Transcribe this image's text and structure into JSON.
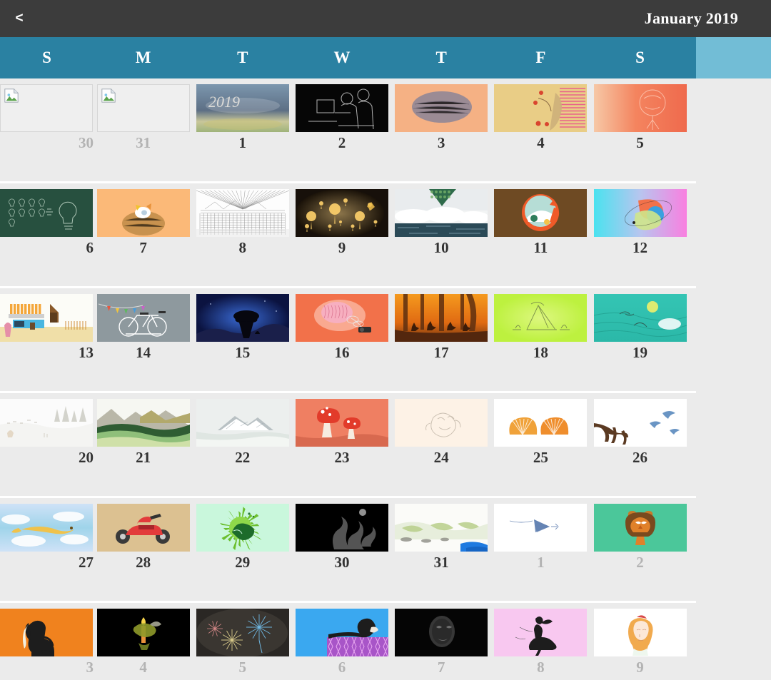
{
  "appbar": {
    "back_icon": "chevron-left-icon",
    "back_label": "<",
    "title": "January 2019",
    "background": "#3c3c3c"
  },
  "weekbar": {
    "background": "#2a81a2",
    "gutter_background": "#72bdd6",
    "days": [
      {
        "label": "S"
      },
      {
        "label": "M"
      },
      {
        "label": "T"
      },
      {
        "label": "W"
      },
      {
        "label": "T"
      },
      {
        "label": "F"
      },
      {
        "label": "S"
      }
    ]
  },
  "calendar": {
    "month": "January",
    "year": "2019",
    "current_day_color": "#333333",
    "other_month_day_color": "#b3b3b3",
    "cell_background": "#ebebeb",
    "row_separator_color": "#ffffff",
    "weeks": [
      {
        "days": [
          {
            "num": "30",
            "in_month": false,
            "has_image": false,
            "image_state": "broken",
            "alt": "missing-thumbnail"
          },
          {
            "num": "31",
            "in_month": false,
            "has_image": false,
            "image_state": "broken",
            "alt": "missing-thumbnail"
          },
          {
            "num": "1",
            "in_month": true,
            "has_image": true,
            "art": "sky2019",
            "alt": "2019 written in clouds over a field"
          },
          {
            "num": "2",
            "in_month": true,
            "has_image": true,
            "art": "sketchfigures",
            "alt": "white line sketch of figures on black"
          },
          {
            "num": "3",
            "in_month": true,
            "has_image": true,
            "art": "furoval",
            "alt": "hairy oval shape on peach background"
          },
          {
            "num": "4",
            "in_month": true,
            "has_image": true,
            "art": "personstripes",
            "alt": "figure with fruit and pink stripes"
          },
          {
            "num": "5",
            "in_month": true,
            "has_image": true,
            "art": "redtree",
            "alt": "pale tree on red-orange wash"
          }
        ]
      },
      {
        "days": [
          {
            "num": "6",
            "in_month": true,
            "has_image": true,
            "art": "chalkboard",
            "alt": "chalkboard with light bulbs"
          },
          {
            "num": "7",
            "in_month": true,
            "has_image": true,
            "art": "nest",
            "alt": "bird in a nest on orange"
          },
          {
            "num": "8",
            "in_month": true,
            "has_image": true,
            "art": "linescape",
            "alt": "pen line drawing of mountains and field"
          },
          {
            "num": "9",
            "in_month": true,
            "has_image": true,
            "art": "goldlights",
            "alt": "glowing golden lights on dark background"
          },
          {
            "num": "10",
            "in_month": true,
            "has_image": true,
            "art": "cloudsea",
            "alt": "clouds above a dark sea"
          },
          {
            "num": "11",
            "in_month": true,
            "has_image": true,
            "art": "foxcircle",
            "alt": "sleeping fox in a circle on brown"
          },
          {
            "num": "12",
            "in_month": true,
            "has_image": true,
            "art": "planetswirl",
            "alt": "abstract swirl on cyan to pink gradient"
          }
        ]
      },
      {
        "days": [
          {
            "num": "13",
            "in_month": true,
            "has_image": true,
            "art": "market",
            "alt": "market stall scene"
          },
          {
            "num": "14",
            "in_month": true,
            "has_image": true,
            "art": "bicycle",
            "alt": "white bicycle and bunting on grey"
          },
          {
            "num": "15",
            "in_month": true,
            "has_image": true,
            "art": "nighttree",
            "alt": "silhouetted tree under a blue night sky"
          },
          {
            "num": "16",
            "in_month": true,
            "has_image": true,
            "art": "brainballoon",
            "alt": "pink brain balloon on orange"
          },
          {
            "num": "17",
            "in_month": true,
            "has_image": true,
            "art": "orangeforest",
            "alt": "deer in an orange forest"
          },
          {
            "num": "18",
            "in_month": true,
            "has_image": true,
            "art": "greenfield",
            "alt": "pencil tent sketch on lime green"
          },
          {
            "num": "19",
            "in_month": true,
            "has_image": true,
            "art": "tealwater",
            "alt": "teal water scene with sun and birds"
          }
        ]
      },
      {
        "days": [
          {
            "num": "20",
            "in_month": true,
            "has_image": true,
            "art": "snowfield",
            "alt": "pale snowy landscape"
          },
          {
            "num": "21",
            "in_month": true,
            "has_image": true,
            "art": "greenmountains",
            "alt": "green mountains and meadow"
          },
          {
            "num": "22",
            "in_month": true,
            "has_image": true,
            "art": "peak",
            "alt": "snow covered peak in mist"
          },
          {
            "num": "23",
            "in_month": true,
            "has_image": true,
            "art": "mushrooms",
            "alt": "red toadstools on salmon background"
          },
          {
            "num": "24",
            "in_month": true,
            "has_image": true,
            "art": "sleepingcreature",
            "alt": "faint sleeping creature on cream"
          },
          {
            "num": "25",
            "in_month": true,
            "has_image": true,
            "art": "orangefruit",
            "alt": "two orange halves on white"
          },
          {
            "num": "26",
            "in_month": true,
            "has_image": true,
            "art": "branchbirds",
            "alt": "bare branch with flying birds"
          }
        ]
      },
      {
        "days": [
          {
            "num": "27",
            "in_month": true,
            "has_image": true,
            "art": "flyingfox",
            "alt": "yellow fox flying over clouds"
          },
          {
            "num": "28",
            "in_month": true,
            "has_image": true,
            "art": "scooter",
            "alt": "red scooter on sand coloured ground"
          },
          {
            "num": "29",
            "in_month": true,
            "has_image": true,
            "art": "greenburst",
            "alt": "green splatter circle on mint"
          },
          {
            "num": "30",
            "in_month": true,
            "has_image": true,
            "art": "smoke",
            "alt": "grey smoke on black"
          },
          {
            "num": "31",
            "in_month": true,
            "has_image": true,
            "art": "greenhills",
            "alt": "pale green hills beside blue water"
          },
          {
            "num": "1",
            "in_month": false,
            "has_image": true,
            "art": "paperplane",
            "alt": "blue paper plane on white"
          },
          {
            "num": "2",
            "in_month": false,
            "has_image": true,
            "art": "owlface",
            "alt": "orange owl face on green"
          }
        ]
      },
      {
        "days": [
          {
            "num": "3",
            "in_month": false,
            "has_image": true,
            "art": "dog",
            "alt": "black dog silhouette on orange"
          },
          {
            "num": "4",
            "in_month": false,
            "has_image": true,
            "art": "candle",
            "alt": "lit candle on black"
          },
          {
            "num": "5",
            "in_month": false,
            "has_image": true,
            "art": "fireworks",
            "alt": "fireworks on dark sky"
          },
          {
            "num": "6",
            "in_month": false,
            "has_image": true,
            "art": "divingwoman",
            "alt": "figure on purple patterned surface, blue background"
          },
          {
            "num": "7",
            "in_month": false,
            "has_image": true,
            "art": "darkface",
            "alt": "faint face on black"
          },
          {
            "num": "8",
            "in_month": false,
            "has_image": true,
            "art": "dancer",
            "alt": "black dancer silhouette on pink"
          },
          {
            "num": "9",
            "in_month": false,
            "has_image": true,
            "art": "portrait",
            "alt": "drawn portrait of a woman on white"
          }
        ]
      }
    ]
  }
}
